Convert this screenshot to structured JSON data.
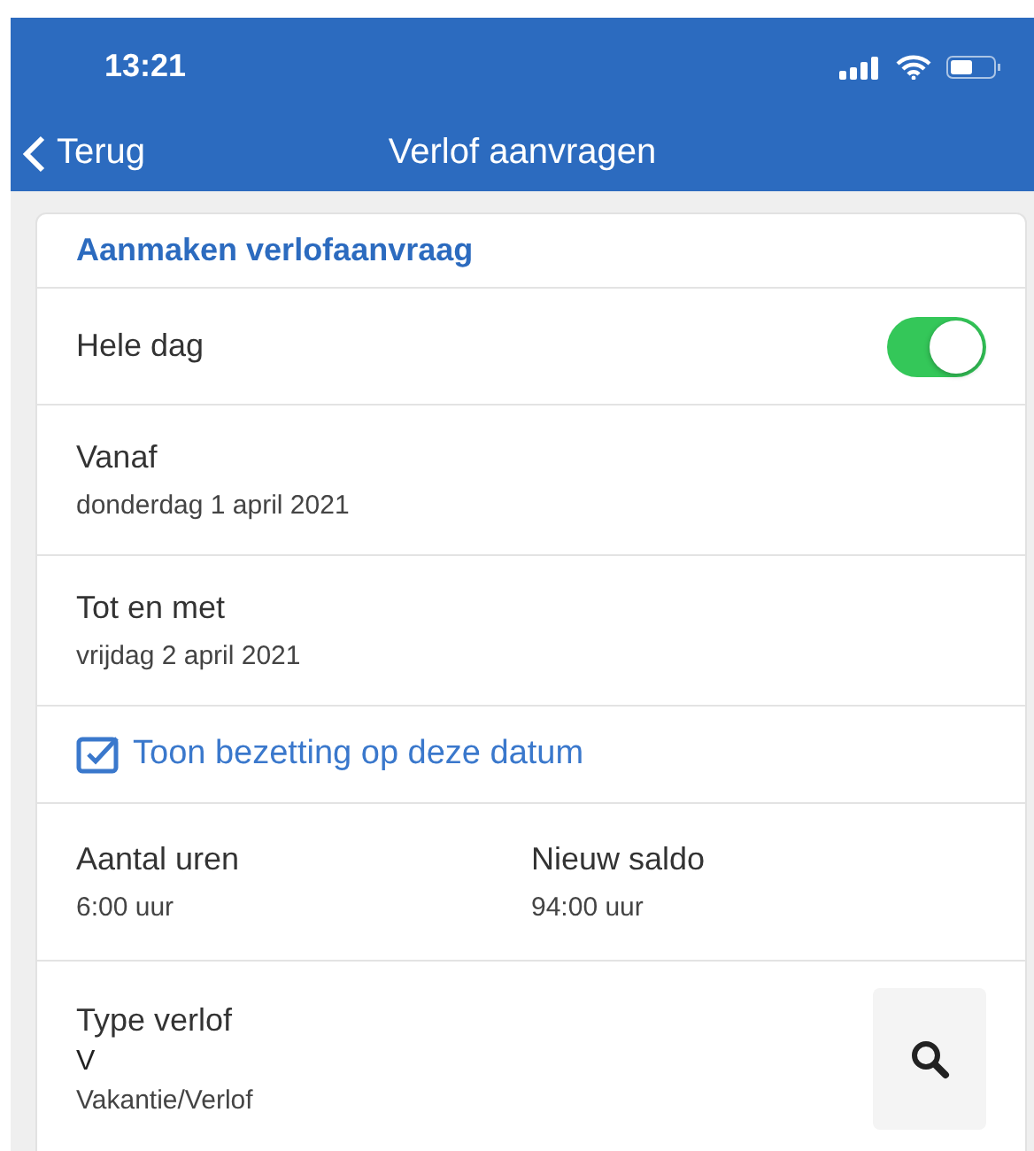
{
  "status_bar": {
    "time": "13:21"
  },
  "nav": {
    "back": "Terug",
    "title": "Verlof aanvragen"
  },
  "section_title": "Aanmaken verlofaanvraag",
  "whole_day": {
    "label": "Hele dag",
    "on": true
  },
  "dates": [
    {
      "label": "Vanaf",
      "value": "donderdag 1 april 2021"
    },
    {
      "label": "Tot en met",
      "value": "vrijdag 2 april 2021"
    }
  ],
  "show_occupancy": {
    "label": "Toon bezetting op deze datum",
    "checked": true
  },
  "hours": {
    "label": "Aantal uren",
    "value": "6:00 uur"
  },
  "new_balance": {
    "label": "Nieuw saldo",
    "value": "94:00 uur"
  },
  "leave_type": {
    "label": "Type verlof",
    "code": "V",
    "description": "Vakantie/Verlof"
  }
}
